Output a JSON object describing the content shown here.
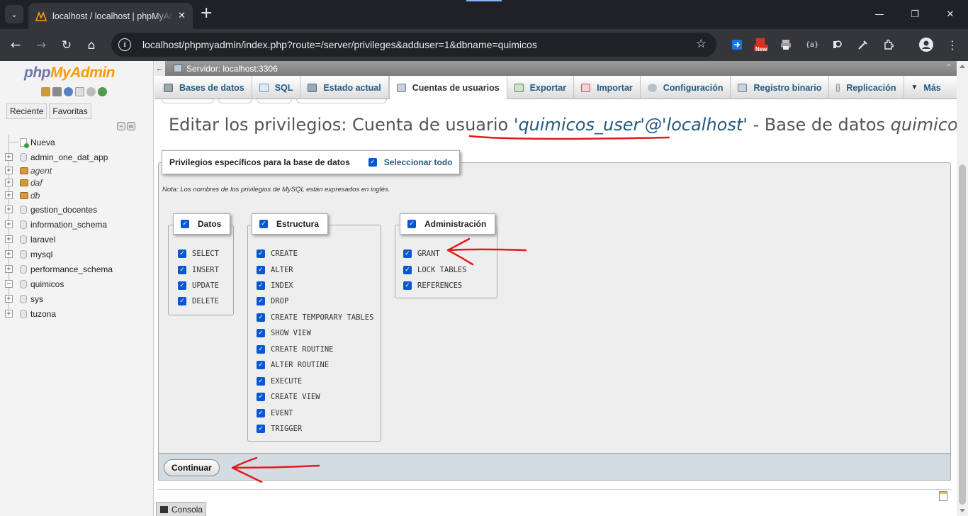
{
  "browser": {
    "tab_title": "localhost / localhost | phpMyAdmin",
    "url": "localhost/phpmyadmin/index.php?route=/server/privileges&adduser=1&dbname=quimicos",
    "new_badge": "New"
  },
  "nav": {
    "logo_php": "php",
    "logo_my": "MyAdmin",
    "tabs": [
      "Reciente",
      "Favoritas"
    ],
    "tree": [
      {
        "label": "Nueva",
        "kind": "new"
      },
      {
        "label": "admin_one_dat_app",
        "kind": "db"
      },
      {
        "label": "agent",
        "kind": "locked"
      },
      {
        "label": "daf",
        "kind": "locked"
      },
      {
        "label": "db",
        "kind": "locked"
      },
      {
        "label": "gestion_docentes",
        "kind": "db"
      },
      {
        "label": "information_schema",
        "kind": "db"
      },
      {
        "label": "laravel",
        "kind": "db"
      },
      {
        "label": "mysql",
        "kind": "db"
      },
      {
        "label": "performance_schema",
        "kind": "db"
      },
      {
        "label": "quimicos",
        "kind": "open"
      },
      {
        "label": "sys",
        "kind": "db"
      },
      {
        "label": "tuzona",
        "kind": "db"
      }
    ]
  },
  "server_bar": {
    "label": "Servidor: localhost:3306"
  },
  "menu": {
    "tabs": [
      {
        "label": "Bases de datos",
        "icon": "database-icon"
      },
      {
        "label": "SQL",
        "icon": "sql-icon"
      },
      {
        "label": "Estado actual",
        "icon": "status-icon"
      },
      {
        "label": "Cuentas de usuarios",
        "icon": "users-icon",
        "active": true
      },
      {
        "label": "Exportar",
        "icon": "export-icon"
      },
      {
        "label": "Importar",
        "icon": "import-icon"
      },
      {
        "label": "Configuración",
        "icon": "wrench-icon"
      },
      {
        "label": "Registro binario",
        "icon": "log-icon"
      },
      {
        "label": "Replicación",
        "icon": "replication-icon"
      },
      {
        "label": "Más",
        "icon": "triangle-down-icon"
      }
    ]
  },
  "title": {
    "prefix": "Editar los privilegios: Cuenta de usuario ",
    "account": "'quimicos_user'@'localhost'",
    "middle": " - Base de datos ",
    "db": "quimicos"
  },
  "privileges": {
    "legend": "Privilegios específicos para la base de datos",
    "select_all": "Seleccionar todo",
    "note": "Nota: Los nombres de los privilegios de MySQL están expresados en inglés.",
    "groups": {
      "datos": {
        "title": "Datos",
        "items": [
          "SELECT",
          "INSERT",
          "UPDATE",
          "DELETE"
        ]
      },
      "estructura": {
        "title": "Estructura",
        "items": [
          "CREATE",
          "ALTER",
          "INDEX",
          "DROP",
          "CREATE TEMPORARY TABLES",
          "SHOW VIEW",
          "CREATE ROUTINE",
          "ALTER ROUTINE",
          "EXECUTE",
          "CREATE VIEW",
          "EVENT",
          "TRIGGER"
        ]
      },
      "admin": {
        "title": "Administración",
        "items": [
          "GRANT",
          "LOCK TABLES",
          "REFERENCES"
        ]
      }
    }
  },
  "buttons": {
    "continue": "Continuar"
  },
  "console": {
    "label": "Consola"
  },
  "colors": {
    "link": "#235a81",
    "checkbox": "#0b57d0",
    "annotation": "#e01b1b",
    "php": "#6c78af",
    "myadmin": "#f89c0e"
  }
}
